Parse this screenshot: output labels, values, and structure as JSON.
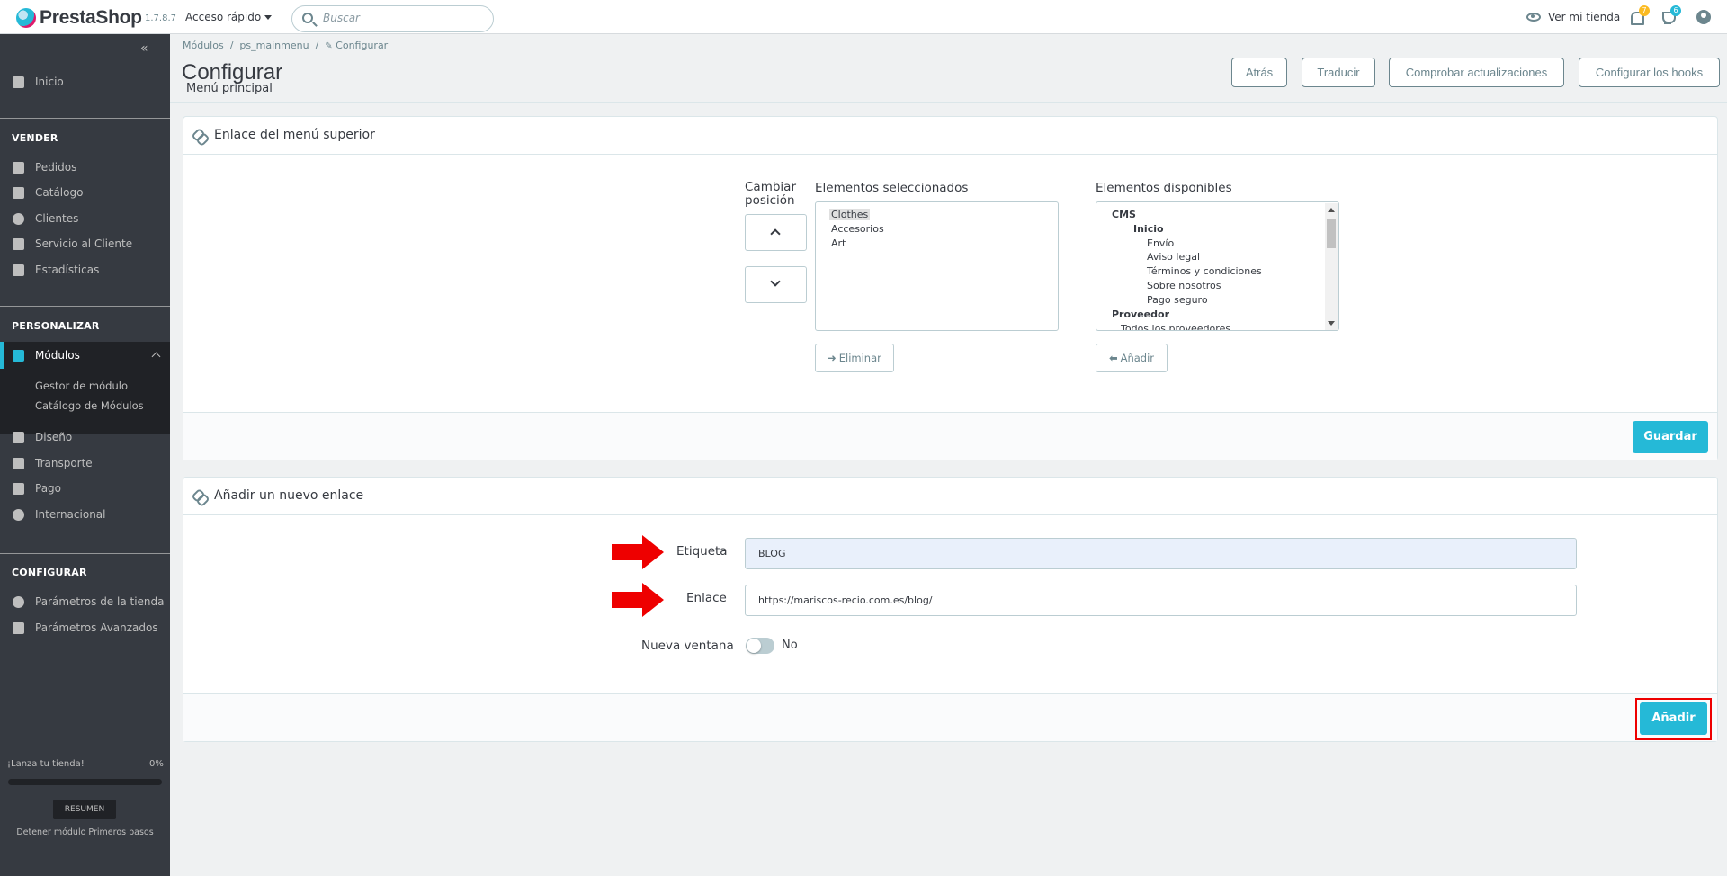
{
  "header": {
    "logo": "PrestaShop",
    "version": "1.7.8.7",
    "quick_access": "Acceso rápido",
    "search_placeholder": "Buscar",
    "view_store": "Ver mi tienda",
    "notif_count": "7",
    "trophy_count": "6"
  },
  "sidebar": {
    "home": "Inicio",
    "sell_title": "VENDER",
    "sell": [
      "Pedidos",
      "Catálogo",
      "Clientes",
      "Servicio al Cliente",
      "Estadísticas"
    ],
    "customize_title": "PERSONALIZAR",
    "modules": "Módulos",
    "modules_sub": [
      "Gestor de módulo",
      "Catálogo de Módulos"
    ],
    "customize": [
      "Diseño",
      "Transporte",
      "Pago",
      "Internacional"
    ],
    "configure_title": "CONFIGURAR",
    "configure": [
      "Parámetros de la tienda",
      "Parámetros Avanzados"
    ],
    "launch_label": "¡Lanza tu tienda!",
    "launch_percent": "0%",
    "launch_progress": 0,
    "resumen": "RESUMEN",
    "stop_module": "Detener módulo Primeros pasos"
  },
  "breadcrumb": [
    "Módulos",
    "ps_mainmenu",
    "Configurar"
  ],
  "page": {
    "title": "Configurar",
    "subtitle": "Menú principal"
  },
  "toolbar": [
    "Atrás",
    "Traducir",
    "Comprobar actualizaciones",
    "Configurar los hooks"
  ],
  "panel1": {
    "title": "Enlace del menú superior",
    "change_position": [
      "Cambiar",
      "posición"
    ],
    "selected_label": "Elementos seleccionados",
    "selected": [
      "Clothes",
      "Accesorios",
      "Art"
    ],
    "available_label": "Elementos disponibles",
    "available": [
      "CMS",
      "Inicio",
      "Envío",
      "Aviso legal",
      "Términos y condiciones",
      "Sobre nosotros",
      "Pago seguro",
      "Proveedor",
      "Todos los proveedores"
    ],
    "remove": "Eliminar",
    "add": "Añadir",
    "save": "Guardar"
  },
  "panel2": {
    "title": "Añadir un nuevo enlace",
    "label_field": "Etiqueta",
    "label_value": "BLOG",
    "link_field": "Enlace",
    "link_value": "https://mariscos-recio.com.es/blog/",
    "new_window": "Nueva ventana",
    "new_window_value": "No",
    "add": "Añadir"
  },
  "colors": {
    "accent": "#25b9d7",
    "sidebar": "#363a41",
    "annotation": "#ee0000"
  }
}
